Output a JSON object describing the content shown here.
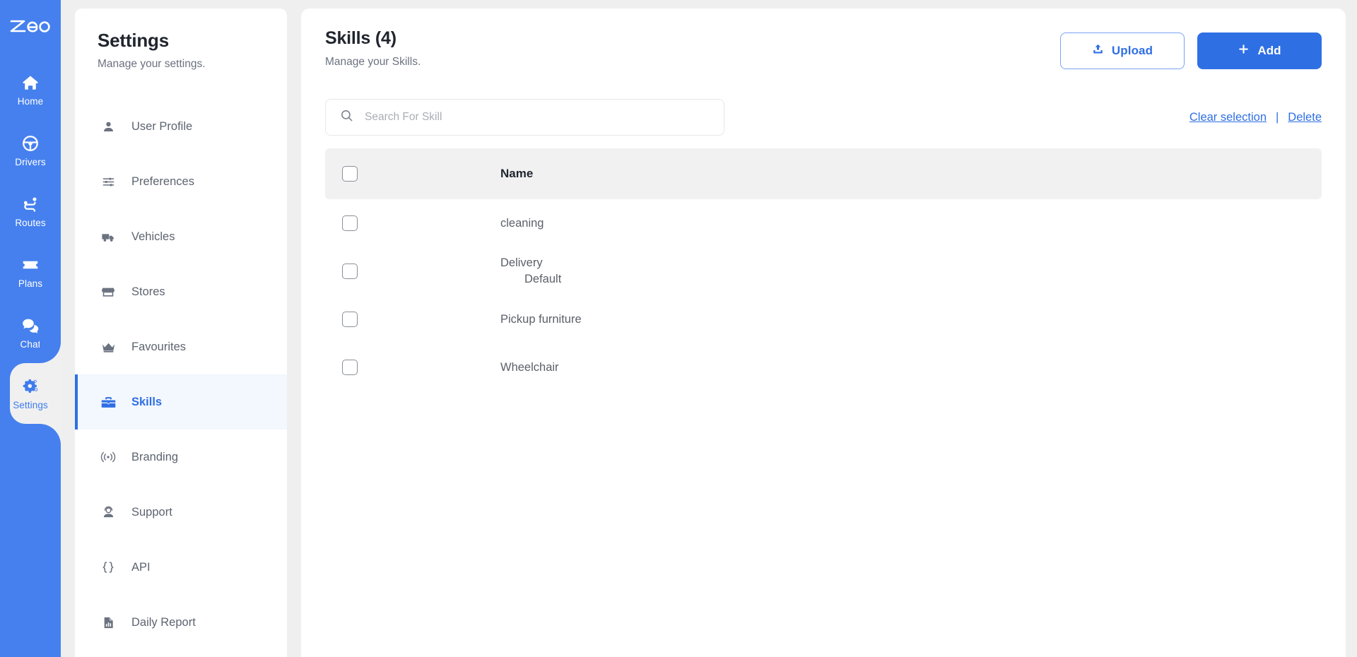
{
  "brand": {
    "logo_text": "zeo",
    "accent": "#2f6fe4",
    "rail_bg": "#4680ee"
  },
  "rail": {
    "items": [
      {
        "label": "Home",
        "icon": "home-icon",
        "active": false
      },
      {
        "label": "Drivers",
        "icon": "steering-wheel-icon",
        "active": false
      },
      {
        "label": "Routes",
        "icon": "route-icon",
        "active": false
      },
      {
        "label": "Plans",
        "icon": "ticket-icon",
        "active": false
      },
      {
        "label": "Chat",
        "icon": "chat-bubbles-icon",
        "active": false
      },
      {
        "label": "Settings",
        "icon": "gears-icon",
        "active": true
      }
    ]
  },
  "settings": {
    "title": "Settings",
    "subtitle": "Manage your settings.",
    "items": [
      {
        "label": "User Profile",
        "icon": "person-icon",
        "active": false
      },
      {
        "label": "Preferences",
        "icon": "sliders-icon",
        "active": false
      },
      {
        "label": "Vehicles",
        "icon": "truck-icon",
        "active": false
      },
      {
        "label": "Stores",
        "icon": "store-icon",
        "active": false
      },
      {
        "label": "Favourites",
        "icon": "crown-icon",
        "active": false
      },
      {
        "label": "Skills",
        "icon": "toolbox-icon",
        "active": true
      },
      {
        "label": "Branding",
        "icon": "broadcast-icon",
        "active": false
      },
      {
        "label": "Support",
        "icon": "support-agent-icon",
        "active": false
      },
      {
        "label": "API",
        "icon": "braces-icon",
        "active": false
      },
      {
        "label": "Daily Report",
        "icon": "report-file-icon",
        "active": false
      }
    ]
  },
  "main": {
    "title": "Skills (4)",
    "subtitle": "Manage your Skills.",
    "upload_label": "Upload",
    "add_label": "Add",
    "upload_icon": "upload-icon",
    "add_icon": "plus-icon",
    "search": {
      "placeholder": "Search For Skill",
      "value": "",
      "icon": "search-icon"
    },
    "clear_selection_label": "Clear selection",
    "separator": "|",
    "delete_label": "Delete",
    "table": {
      "columns": [
        "Name"
      ],
      "header_name": "Name",
      "rows": [
        {
          "name": "cleaning",
          "sub": "",
          "checked": false
        },
        {
          "name": "Delivery",
          "sub": "Default",
          "checked": false
        },
        {
          "name": "Pickup furniture",
          "sub": "",
          "checked": false
        },
        {
          "name": "Wheelchair",
          "sub": "",
          "checked": false
        }
      ]
    }
  }
}
